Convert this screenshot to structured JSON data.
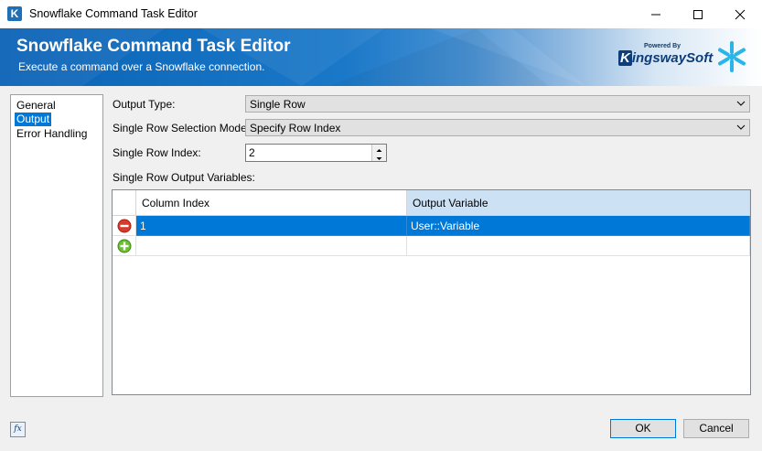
{
  "window": {
    "title": "Snowflake Command Task Editor",
    "icon_letter": "K"
  },
  "banner": {
    "title": "Snowflake Command Task Editor",
    "subtitle": "Execute a command over a Snowflake connection.",
    "logo_powered": "Powered By",
    "logo_k": "K",
    "logo_name": "ingswaySoft"
  },
  "nav": {
    "items": [
      {
        "label": "General",
        "selected": false
      },
      {
        "label": "Output",
        "selected": true
      },
      {
        "label": "Error Handling",
        "selected": false
      }
    ]
  },
  "form": {
    "output_type_label": "Output Type:",
    "output_type_value": "Single Row",
    "selection_mode_label": "Single Row Selection Mode:",
    "selection_mode_value": "Specify Row Index",
    "row_index_label": "Single Row Index:",
    "row_index_value": "2",
    "output_vars_label": "Single Row Output Variables:"
  },
  "grid": {
    "columns": [
      "Column Index",
      "Output Variable"
    ],
    "rows": [
      {
        "column_index": "1",
        "output_variable": "User::Variable"
      }
    ]
  },
  "footer": {
    "fx_label": "fx",
    "ok_label": "OK",
    "cancel_label": "Cancel"
  },
  "colors": {
    "accent": "#0078d7",
    "banner": "#0b63b6",
    "header_selected": "#cce1f4"
  }
}
